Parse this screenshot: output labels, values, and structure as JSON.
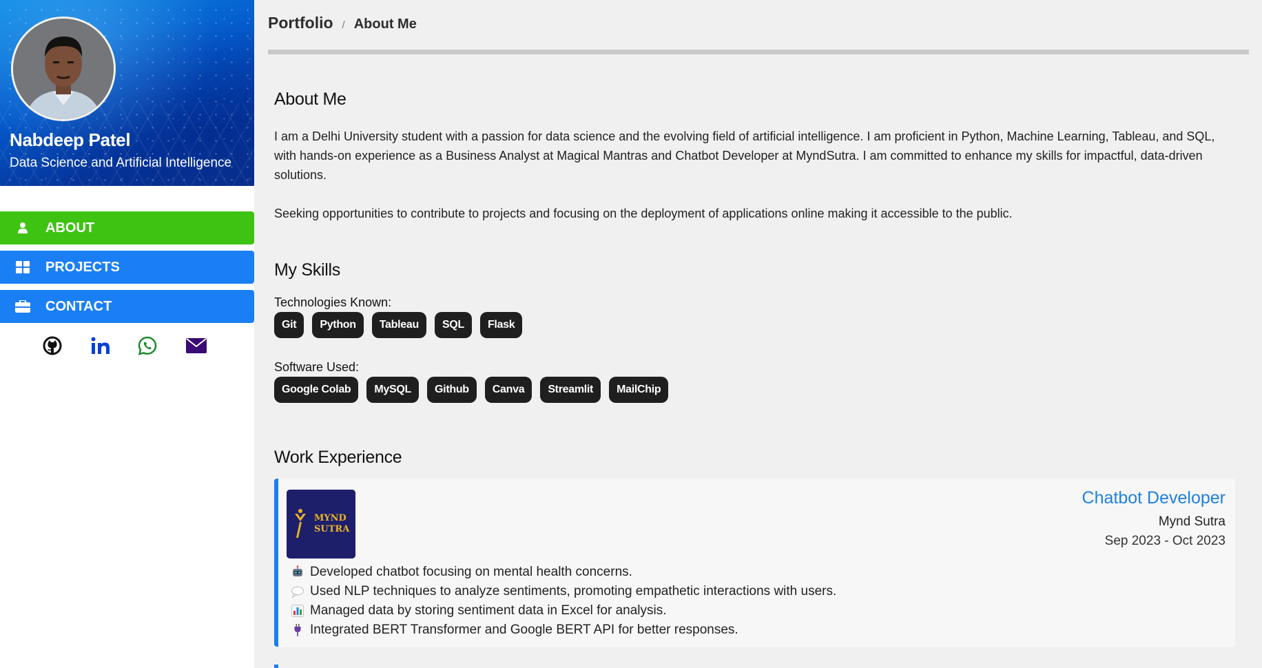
{
  "profile": {
    "name": "Nabdeep Patel",
    "title": "Data Science and Artificial Intelligence"
  },
  "nav": {
    "items": [
      {
        "label": "ABOUT",
        "icon": "user-icon",
        "active": true
      },
      {
        "label": "PROJECTS",
        "icon": "grid-icon",
        "active": false
      },
      {
        "label": "CONTACT",
        "icon": "briefcase-icon",
        "active": false
      }
    ]
  },
  "social": [
    {
      "icon": "github-icon",
      "color": "#111111"
    },
    {
      "icon": "linkedin-icon",
      "color": "#0a3fd8"
    },
    {
      "icon": "whatsapp-icon",
      "color": "#1e8a2e"
    },
    {
      "icon": "email-icon",
      "color": "#3b0a75"
    }
  ],
  "breadcrumb": {
    "root": "Portfolio",
    "separator": "/",
    "current": "About Me"
  },
  "about": {
    "heading": "About Me",
    "paragraph1": "I am a Delhi University student with a passion for data science and the evolving field of artificial intelligence. I am proficient in Python, Machine Learning, Tableau, and SQL, with hands-on experience as a Business Analyst at Magical Mantras and Chatbot Developer at MyndSutra. I am committed to enhance my skills for impactful, data-driven solutions.",
    "paragraph2": "Seeking opportunities to contribute to projects and focusing on the deployment of applications online making it accessible to the public."
  },
  "skills": {
    "heading": "My Skills",
    "technologies_label": "Technologies Known:",
    "technologies": [
      "Git",
      "Python",
      "Tableau",
      "SQL",
      "Flask"
    ],
    "software_label": "Software Used:",
    "software": [
      "Google Colab",
      "MySQL",
      "Github",
      "Canva",
      "Streamlit",
      "MailChip"
    ]
  },
  "work": {
    "heading": "Work Experience",
    "jobs": [
      {
        "logo_text_line1": "MYND",
        "logo_text_line2": "SUTRA",
        "role": "Chatbot Developer",
        "company": "Mynd Sutra",
        "dates": "Sep 2023 - Oct 2023",
        "duties": [
          {
            "icon": "robot-icon",
            "text": "Developed chatbot focusing on mental health concerns."
          },
          {
            "icon": "speech-bubble-icon",
            "text": "Used NLP techniques to analyze sentiments, promoting empathetic interactions with users."
          },
          {
            "icon": "bar-chart-icon",
            "text": "Managed data by storing sentiment data in Excel for analysis."
          },
          {
            "icon": "plug-icon",
            "text": "Integrated BERT Transformer and Google BERT API for better responses."
          }
        ]
      }
    ]
  },
  "colors": {
    "active_nav": "#3ec312",
    "nav": "#1a7ff5",
    "role_text": "#1f80e0",
    "chip_bg": "#1f1f1f",
    "card_accent": "#1a7ff5"
  }
}
